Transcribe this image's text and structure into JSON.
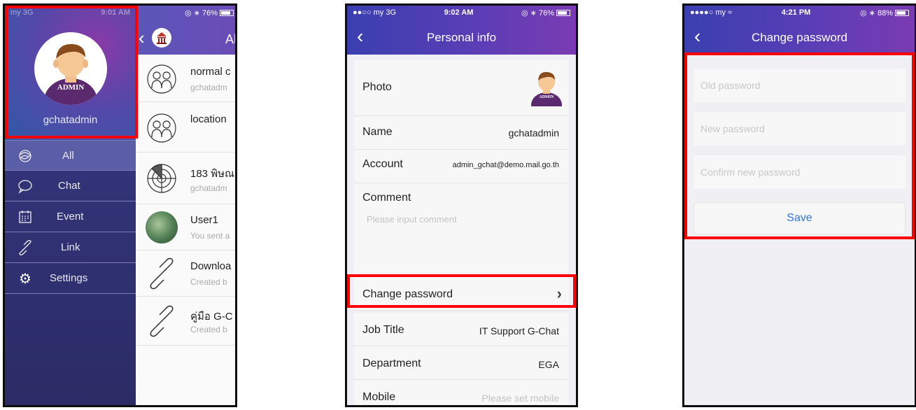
{
  "colors": {
    "highlight": "#ff0000",
    "accent_blue": "#2f73d8",
    "nav_purple": "#5a3eb6"
  },
  "screen1": {
    "status": {
      "left": "my 3G",
      "time": "9:01 AM",
      "battery": "76%"
    },
    "sidebar": {
      "avatar_badge": "ADMIN",
      "username": "gchatadmin",
      "items": [
        {
          "icon": "doodle-all-icon",
          "label": "All"
        },
        {
          "icon": "chat-bubble-icon",
          "label": "Chat"
        },
        {
          "icon": "calendar-icon",
          "label": "Event"
        },
        {
          "icon": "link-icon",
          "label": "Link"
        },
        {
          "icon": "gear-icon",
          "label": "Settings"
        }
      ]
    },
    "list": {
      "header_title": "All",
      "items": [
        {
          "icon": "group-icon",
          "title": "normal c",
          "subtitle": "gchatadm"
        },
        {
          "icon": "group-icon",
          "title": "location",
          "subtitle": ""
        },
        {
          "icon": "radar-icon",
          "title": "183 พิษณ",
          "subtitle": "gchatadm"
        },
        {
          "icon": "user-photo-icon",
          "title": "User1",
          "subtitle": "You sent a"
        },
        {
          "icon": "link-icon",
          "title": "Downloa",
          "subtitle": "Created b"
        },
        {
          "icon": "link-icon",
          "title": "คู่มือ G-C",
          "subtitle": "Created b"
        }
      ]
    }
  },
  "screen2": {
    "status": {
      "left": "my 3G",
      "time": "9:02 AM",
      "battery": "76%"
    },
    "title": "Personal info",
    "photo_label": "Photo",
    "avatar_badge": "ADMIN",
    "name_label": "Name",
    "name_value": "gchatadmin",
    "account_label": "Account",
    "account_value": "admin_gchat@demo.mail.go.th",
    "comment_label": "Comment",
    "comment_placeholder": "Please input comment",
    "change_password_label": "Change password",
    "job_title_label": "Job Title",
    "job_title_value": "IT Support G-Chat",
    "department_label": "Department",
    "department_value": "EGA",
    "mobile_label": "Mobile",
    "mobile_placeholder": "Please set mobile"
  },
  "screen3": {
    "status": {
      "left": "my",
      "time": "4:21 PM",
      "battery": "88%"
    },
    "title": "Change password",
    "old_placeholder": "Old password",
    "new_placeholder": "New password",
    "confirm_placeholder": "Confirm new password",
    "save_label": "Save"
  }
}
